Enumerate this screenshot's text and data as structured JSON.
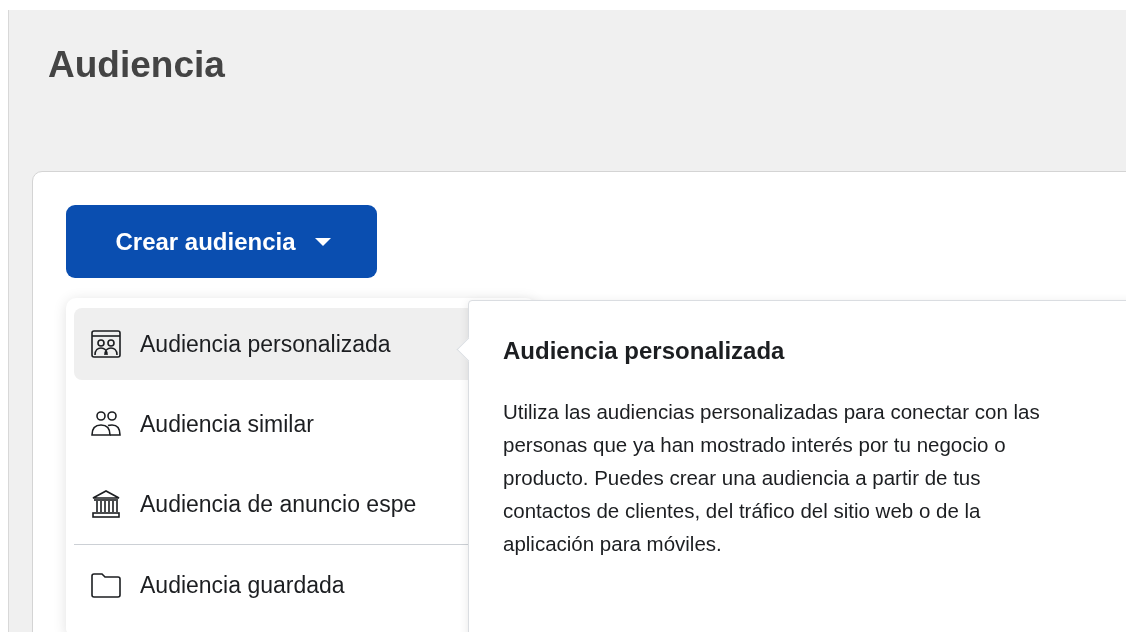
{
  "page": {
    "title": "Audiencia"
  },
  "create_button": {
    "label": "Crear audiencia"
  },
  "menu": {
    "items": [
      {
        "label": "Audiencia personalizada",
        "kind": "custom",
        "selected": true,
        "separator_above": false
      },
      {
        "label": "Audiencia similar",
        "kind": "people",
        "selected": false,
        "separator_above": false
      },
      {
        "label": "Audiencia de anuncio espe",
        "kind": "building",
        "selected": false,
        "separator_above": false
      },
      {
        "label": "Audiencia guardada",
        "kind": "folder",
        "selected": false,
        "separator_above": true
      }
    ]
  },
  "tooltip": {
    "title": "Audiencia personalizada",
    "text": "Utiliza las audiencias personalizadas para conectar con las personas que ya han mostrado interés por tu negocio o producto. Puedes crear una audiencia a partir de tus contactos de clientes, del tráfico del sitio web o de la aplicación para móviles."
  }
}
